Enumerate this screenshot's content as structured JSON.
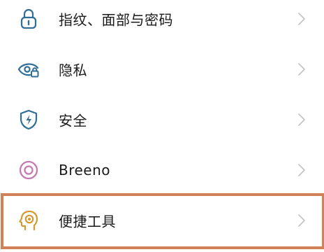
{
  "settings": {
    "items": [
      {
        "label": "指纹、面部与密码",
        "icon": "lock-icon",
        "color": "#2e6e97"
      },
      {
        "label": "隐私",
        "icon": "privacy-eye-icon",
        "color": "#2e6e97"
      },
      {
        "label": "安全",
        "icon": "shield-bolt-icon",
        "color": "#2e6e97"
      },
      {
        "label": "Breeno",
        "icon": "breeno-ring-icon",
        "color": "#c77ab0"
      },
      {
        "label": "便捷工具",
        "icon": "head-target-icon",
        "color": "#d39a2f"
      }
    ],
    "highlight_color": "#d08256",
    "chevron_color": "#c4c4c4"
  }
}
